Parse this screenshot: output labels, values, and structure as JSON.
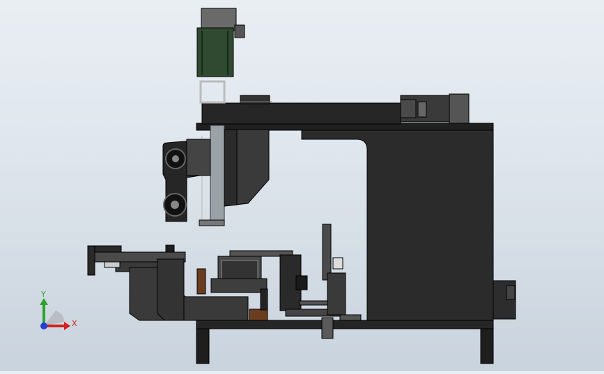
{
  "viewport": {
    "background_top": "#e9eef3",
    "background_bottom": "#c9d3dd"
  },
  "triad": {
    "x_label": "X",
    "y_label": "Y",
    "x_color": "#d32020",
    "y_color": "#2aa52a",
    "z_color": "#1f3fd6"
  },
  "model": {
    "body_color": "#2a2a2a",
    "dark_color": "#1c1c1c",
    "edge_color": "#0a0a0a",
    "steel_color": "#9aa2a8",
    "wood_color": "#6b3d1f",
    "motor_color": "#2f4a30"
  }
}
